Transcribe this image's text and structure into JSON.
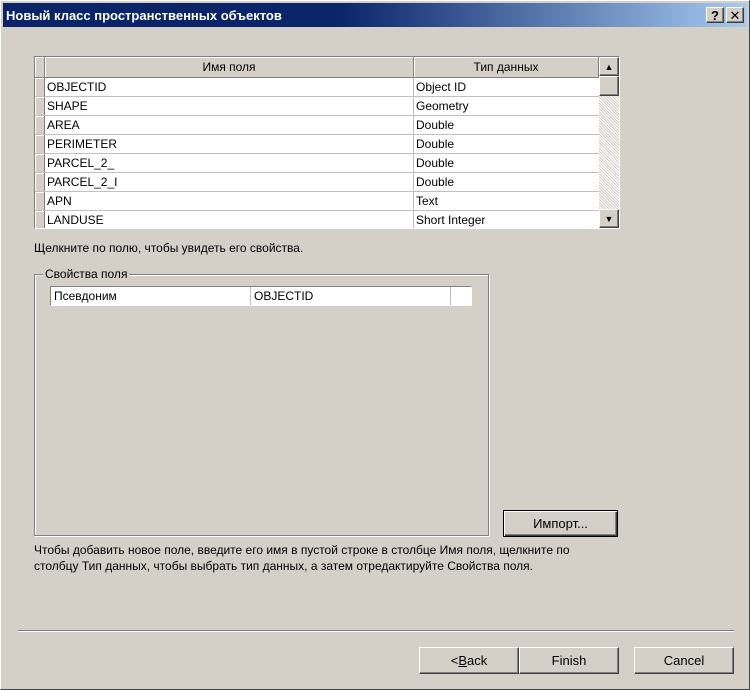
{
  "window": {
    "title": "Новый класс пространственных объектов",
    "help_label": "?",
    "close_label": "✕"
  },
  "grid": {
    "columns": [
      "Имя поля",
      "Тип данных"
    ],
    "rows": [
      {
        "name": "OBJECTID",
        "type": "Object ID"
      },
      {
        "name": "SHAPE",
        "type": "Geometry"
      },
      {
        "name": "AREA",
        "type": "Double"
      },
      {
        "name": "PERIMETER",
        "type": "Double"
      },
      {
        "name": "PARCEL_2_",
        "type": "Double"
      },
      {
        "name": "PARCEL_2_I",
        "type": "Double"
      },
      {
        "name": "APN",
        "type": "Text"
      },
      {
        "name": "LANDUSE",
        "type": "Short Integer"
      }
    ],
    "scroll_up_icon": "scroll-up-arrow",
    "scroll_down_icon": "scroll-down-arrow"
  },
  "hint": "Щелкните по полю, чтобы увидеть его свойства.",
  "field_properties": {
    "legend": "Свойства поля",
    "rows": [
      {
        "property": "Псевдоним",
        "value": "OBJECTID"
      }
    ]
  },
  "import_button": "Импорт...",
  "instructions": "Чтобы добавить новое поле, введите его имя в пустой строке в столбце Имя поля, щелкните по столбцу Тип данных, чтобы выбрать тип данных, а затем отредактируйте Свойства поля.",
  "buttons": {
    "back_prefix": "< ",
    "back_mnemonic": "B",
    "back_rest": "ack",
    "finish": "Finish",
    "cancel": "Cancel"
  }
}
